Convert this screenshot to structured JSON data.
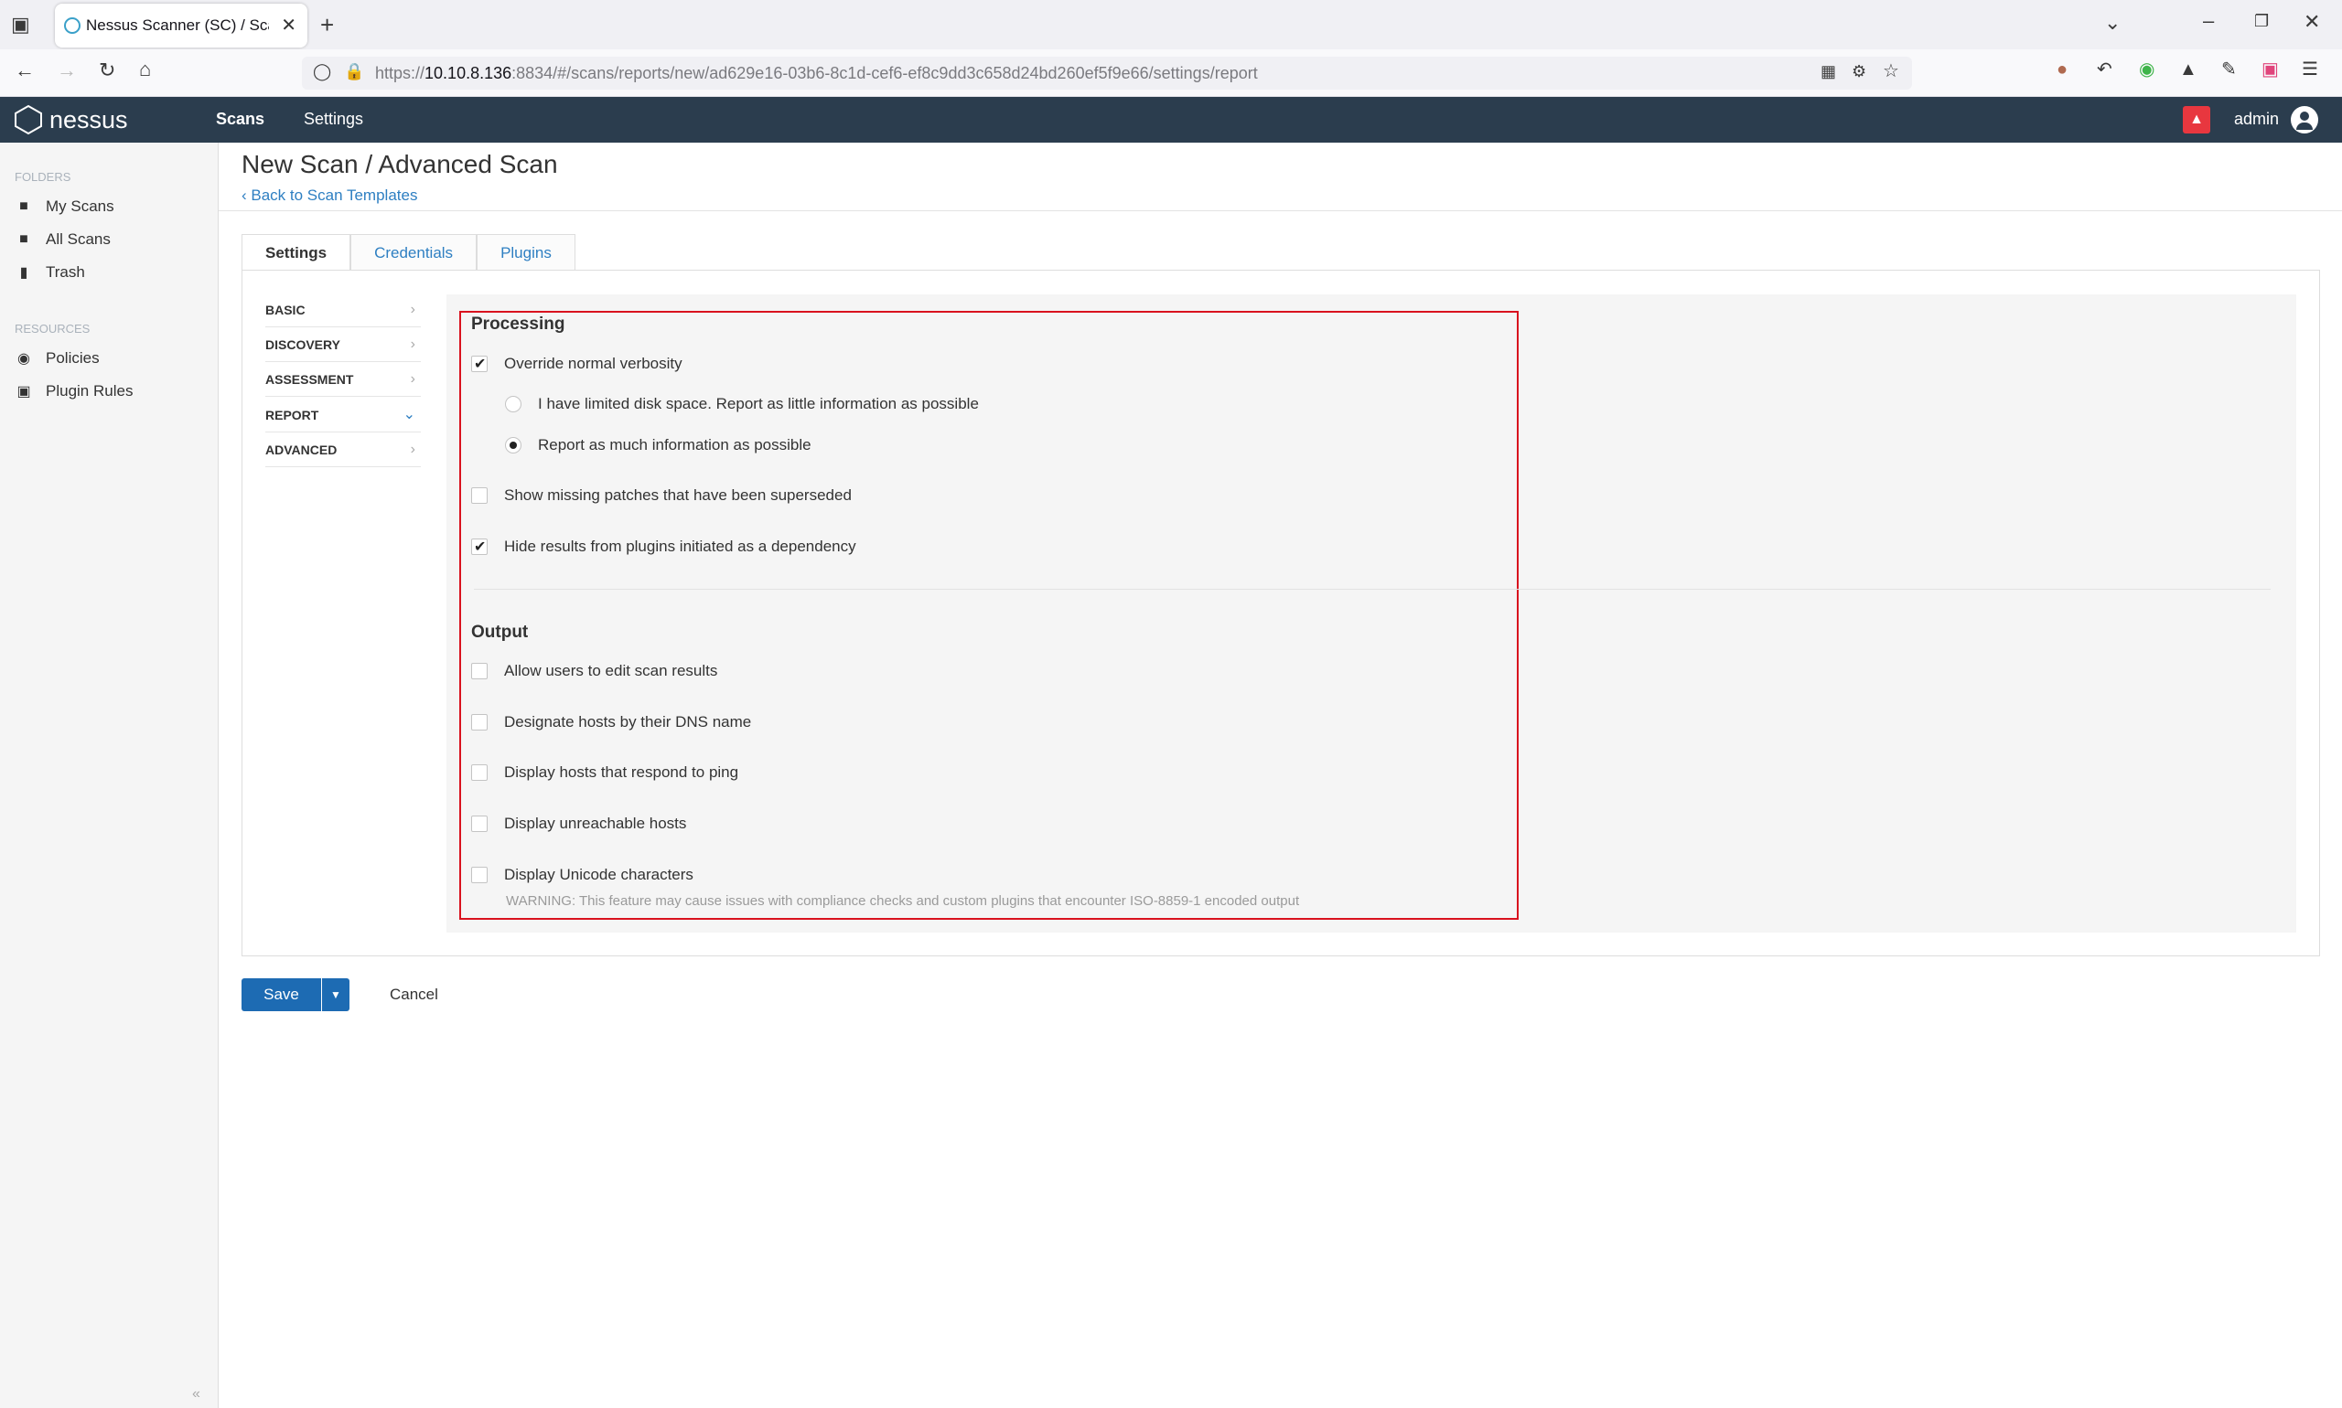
{
  "browser": {
    "tab_title": "Nessus Scanner (SC) / Scans",
    "url_prefix": "https://",
    "url_host": "10.10.8.136",
    "url_rest": ":8834/#/scans/reports/new/ad629e16-03b6-8c1d-cef6-ef8c9dd3c658d24bd260ef5f9e66/settings/report"
  },
  "app": {
    "logo_text": "nessus",
    "nav": [
      "Scans",
      "Settings"
    ],
    "user": "admin"
  },
  "sidebar": {
    "folders_label": "FOLDERS",
    "folders": [
      "My Scans",
      "All Scans",
      "Trash"
    ],
    "resources_label": "RESOURCES",
    "resources": [
      "Policies",
      "Plugin Rules"
    ]
  },
  "page": {
    "title": "New Scan / Advanced Scan",
    "back_link": "Back to Scan Templates",
    "tabs": [
      "Settings",
      "Credentials",
      "Plugins"
    ],
    "menu": [
      "BASIC",
      "DISCOVERY",
      "ASSESSMENT",
      "REPORT",
      "ADVANCED"
    ]
  },
  "processing": {
    "heading": "Processing",
    "override": {
      "label": "Override normal verbosity",
      "checked": true
    },
    "radio_limited": {
      "label": "I have limited disk space. Report as little information as possible",
      "selected": false
    },
    "radio_much": {
      "label": "Report as much information as possible",
      "selected": true
    },
    "superseded": {
      "label": "Show missing patches that have been superseded",
      "checked": false
    },
    "hide_dep": {
      "label": "Hide results from plugins initiated as a dependency",
      "checked": true
    }
  },
  "output": {
    "heading": "Output",
    "items": [
      {
        "label": "Allow users to edit scan results",
        "checked": false
      },
      {
        "label": "Designate hosts by their DNS name",
        "checked": false
      },
      {
        "label": "Display hosts that respond to ping",
        "checked": false
      },
      {
        "label": "Display unreachable hosts",
        "checked": false
      },
      {
        "label": "Display Unicode characters",
        "checked": false
      }
    ],
    "warning": "WARNING: This feature may cause issues with compliance checks and custom plugins that encounter ISO-8859-1 encoded output"
  },
  "actions": {
    "save": "Save",
    "cancel": "Cancel"
  },
  "colors": {
    "header": "#2b3d4e",
    "primary": "#1d6bb3",
    "highlight_box": "#d9121e",
    "link": "#2e7fc2"
  }
}
